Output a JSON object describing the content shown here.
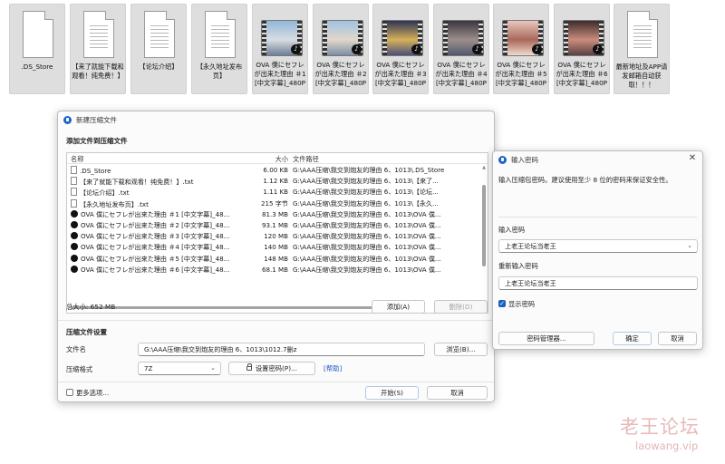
{
  "desktop": {
    "files": [
      {
        "label": ".DS_Store",
        "type": "blank"
      },
      {
        "label": "【来了就能下载和观看！纯免费！】",
        "type": "doc"
      },
      {
        "label": "【论坛介绍】",
        "type": "doc"
      },
      {
        "label": "【永久地址发布页】",
        "type": "doc"
      },
      {
        "label": "OVA 僕にセフレが出来た理由 ＃1 [中文字幕]_480P",
        "type": "video",
        "thumb_colors": [
          "#8fb7d9",
          "#d9dce2",
          "#6c7f96"
        ]
      },
      {
        "label": "OVA 僕にセフレが出来た理由 ＃2 [中文字幕]_480P",
        "type": "video",
        "thumb_colors": [
          "#9fc3e3",
          "#e2d7c9",
          "#7b8ea5"
        ]
      },
      {
        "label": "OVA 僕にセフレが出来た理由 ＃3 [中文字幕]_480P",
        "type": "video",
        "thumb_colors": [
          "#2c3355",
          "#d6b15a",
          "#4a4f7a"
        ]
      },
      {
        "label": "OVA 僕にセフレが出来た理由 ＃4 [中文字幕]_480P",
        "type": "video",
        "thumb_colors": [
          "#3b3440",
          "#9c8f8a",
          "#52586e"
        ]
      },
      {
        "label": "OVA 僕にセフレが出来た理由 ＃5 [中文字幕]_480P",
        "type": "video",
        "thumb_colors": [
          "#e8c7bd",
          "#a9685a",
          "#f0d9cf"
        ]
      },
      {
        "label": "OVA 僕にセフレが出来た理由 ＃6 [中文字幕]_480P",
        "type": "video",
        "thumb_colors": [
          "#3d2b2c",
          "#c98d7c",
          "#5a4242"
        ]
      },
      {
        "label": "最新地址及APP请发邮箱自动获取！！！",
        "type": "doc"
      }
    ]
  },
  "main_window": {
    "title": "新建压缩文件",
    "add_section_title": "添加文件到压缩文件",
    "columns": {
      "name": "名称",
      "size": "大小",
      "path": "文件路径"
    },
    "rows": [
      {
        "name": ".DS_Store",
        "size": "6.00 KB",
        "path": "G:\\AAA压缩\\我交到炮友的理由 6、1013\\.DS_Store",
        "icon": "file"
      },
      {
        "name": "【来了就能下载和观看！纯免费！】.txt",
        "size": "1.12 KB",
        "path": "G:\\AAA压缩\\我交到炮友的理由 6、1013\\【来了...",
        "icon": "text"
      },
      {
        "name": "【论坛介绍】.txt",
        "size": "1.11 KB",
        "path": "G:\\AAA压缩\\我交到炮友的理由 6、1013\\【论坛...",
        "icon": "text"
      },
      {
        "name": "【永久地址发布页】.txt",
        "size": "215 字节",
        "path": "G:\\AAA压缩\\我交到炮友的理由 6、1013\\【永久...",
        "icon": "text"
      },
      {
        "name": "OVA 僕にセフレが出来た理由 ＃1 [中文字幕]_48...",
        "size": "81.3 MB",
        "path": "G:\\AAA压缩\\我交到炮友的理由 6、1013\\OVA 僕...",
        "icon": "video"
      },
      {
        "name": "OVA 僕にセフレが出来た理由 ＃2 [中文字幕]_48...",
        "size": "93.1 MB",
        "path": "G:\\AAA压缩\\我交到炮友的理由 6、1013\\OVA 僕...",
        "icon": "video"
      },
      {
        "name": "OVA 僕にセフレが出来た理由 ＃3 [中文字幕]_48...",
        "size": "120 MB",
        "path": "G:\\AAA压缩\\我交到炮友的理由 6、1013\\OVA 僕...",
        "icon": "video"
      },
      {
        "name": "OVA 僕にセフレが出来た理由 ＃4 [中文字幕]_48...",
        "size": "140 MB",
        "path": "G:\\AAA压缩\\我交到炮友的理由 6、1013\\OVA 僕...",
        "icon": "video"
      },
      {
        "name": "OVA 僕にセフレが出来た理由 ＃5 [中文字幕]_48...",
        "size": "148 MB",
        "path": "G:\\AAA压缩\\我交到炮友的理由 6、1013\\OVA 僕...",
        "icon": "video"
      },
      {
        "name": "OVA 僕にセフレが出来た理由 ＃6 [中文字幕]_48...",
        "size": "68.1 MB",
        "path": "G:\\AAA压缩\\我交到炮友的理由 6、1013\\OVA 僕...",
        "icon": "video"
      }
    ],
    "total_size": "总大小: 652 MB",
    "add_button": "添加(A)",
    "delete_button": "删除(D)",
    "settings_section_title": "压缩文件设置",
    "filename_label": "文件名",
    "filename_value": "G:\\AAA压缩\\我交到炮友的理由 6、1013\\1012.7删z",
    "browse_button": "浏览(B)...",
    "format_label": "压缩格式",
    "format_value": "7Z",
    "set_password_button": "设置密码(P)...",
    "help_link": "[帮助]",
    "more_options_label": "更多选项...",
    "start_button": "开始(S)",
    "cancel_button": "取消"
  },
  "password_window": {
    "title": "输入密码",
    "description": "输入压缩包密码。建议使用至少 8 位的密码来保证安全性。",
    "password_label": "输入密码",
    "password_value": "上老王论坛当老王",
    "confirm_label": "重新输入密码",
    "confirm_value": "上老王论坛当老王",
    "show_password_label": "显示密码",
    "show_password_checked": true,
    "manager_button": "密码管理器...",
    "ok_button": "确定",
    "cancel_button": "取消"
  },
  "watermark": {
    "main": "老王论坛",
    "sub": "laowang.vip"
  }
}
